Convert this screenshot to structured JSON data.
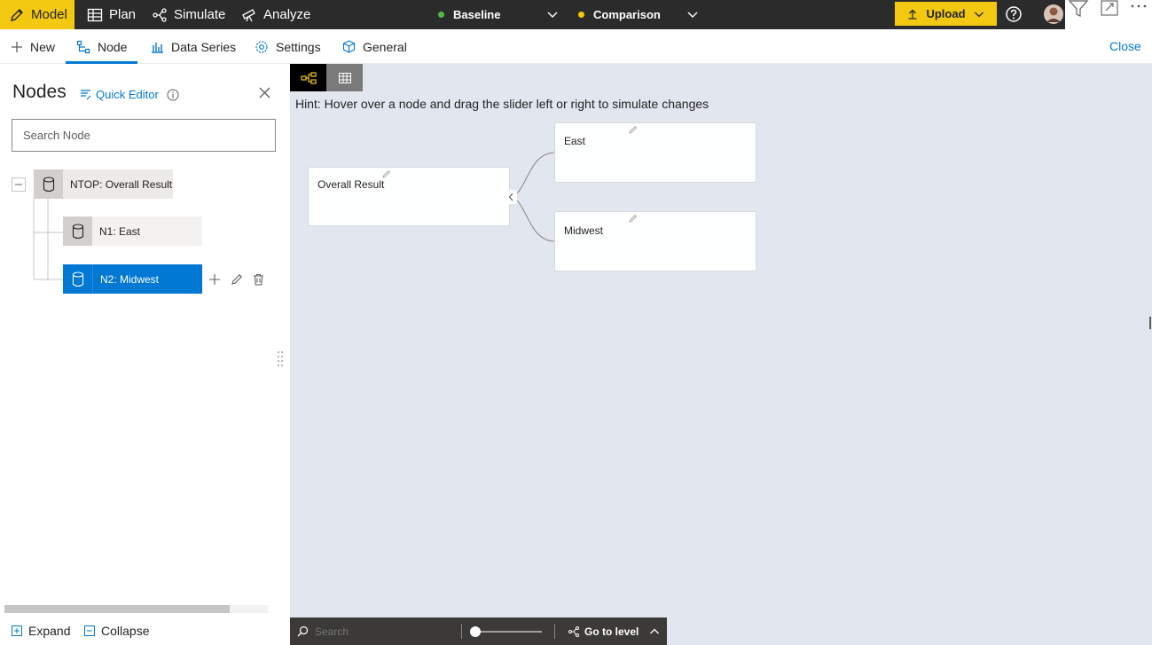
{
  "topbar": {
    "nav": [
      {
        "label": "Model",
        "icon": "pencil-icon",
        "active": true
      },
      {
        "label": "Plan",
        "icon": "table-icon",
        "active": false
      },
      {
        "label": "Simulate",
        "icon": "branch-icon",
        "active": false
      },
      {
        "label": "Analyze",
        "icon": "telescope-icon",
        "active": false
      }
    ],
    "baseline": {
      "label": "Baseline",
      "color": "#54b94a"
    },
    "comparison": {
      "label": "Comparison",
      "color": "#f2c811"
    },
    "upload_label": "Upload"
  },
  "subbar": {
    "tabs": [
      {
        "label": "New",
        "icon": "plus-icon"
      },
      {
        "label": "Node",
        "icon": "hierarchy-icon",
        "active": true
      },
      {
        "label": "Data Series",
        "icon": "bar-chart-icon"
      },
      {
        "label": "Settings",
        "icon": "gear-icon"
      },
      {
        "label": "General",
        "icon": "cube-icon"
      }
    ],
    "close_label": "Close"
  },
  "panel": {
    "title": "Nodes",
    "quick_editor": "Quick Editor",
    "search_placeholder": "Search Node",
    "tree": [
      {
        "label": "NTOP: Overall Result"
      },
      {
        "label": "N1: East"
      },
      {
        "label": "N2: Midwest",
        "selected": true
      }
    ],
    "expand_label": "Expand",
    "collapse_label": "Collapse"
  },
  "canvas": {
    "hint": "Hint: Hover over a node and drag the slider left or right to simulate changes",
    "nodes": [
      {
        "label": "Overall Result"
      },
      {
        "label": "East"
      },
      {
        "label": "Midwest"
      }
    ]
  },
  "bottom": {
    "search_placeholder": "Search",
    "go_to_level": "Go to level"
  }
}
